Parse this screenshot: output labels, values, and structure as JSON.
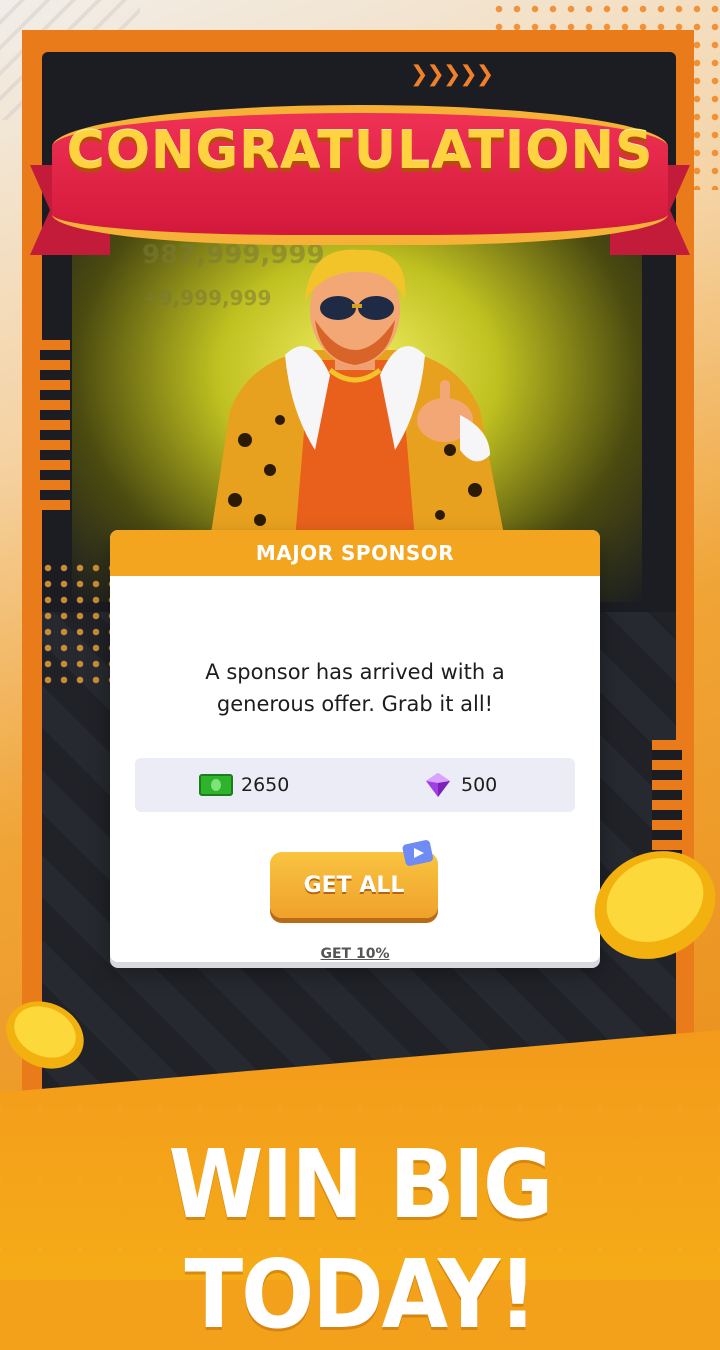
{
  "banner": {
    "title": "CONGRATULATIONS"
  },
  "background_ghost": {
    "balance": "987,999,999",
    "income": "+9,999,999"
  },
  "modal": {
    "header": "MAJOR SPONSOR",
    "message_line1": "A sponsor has arrived with a",
    "message_line2": "generous offer. Grab it all!",
    "rewards": [
      {
        "icon": "cash-icon",
        "value": "2650"
      },
      {
        "icon": "gem-icon",
        "value": "500"
      }
    ],
    "primary_button": "GET ALL",
    "secondary_link": "GET 10%"
  },
  "promo": {
    "headline": "WIN BIG TODAY!"
  },
  "colors": {
    "accent_orange": "#f4a51f",
    "ribbon_red": "#d3193b",
    "ribbon_text": "#ffd23f",
    "frame_orange": "#ea7b1a"
  }
}
